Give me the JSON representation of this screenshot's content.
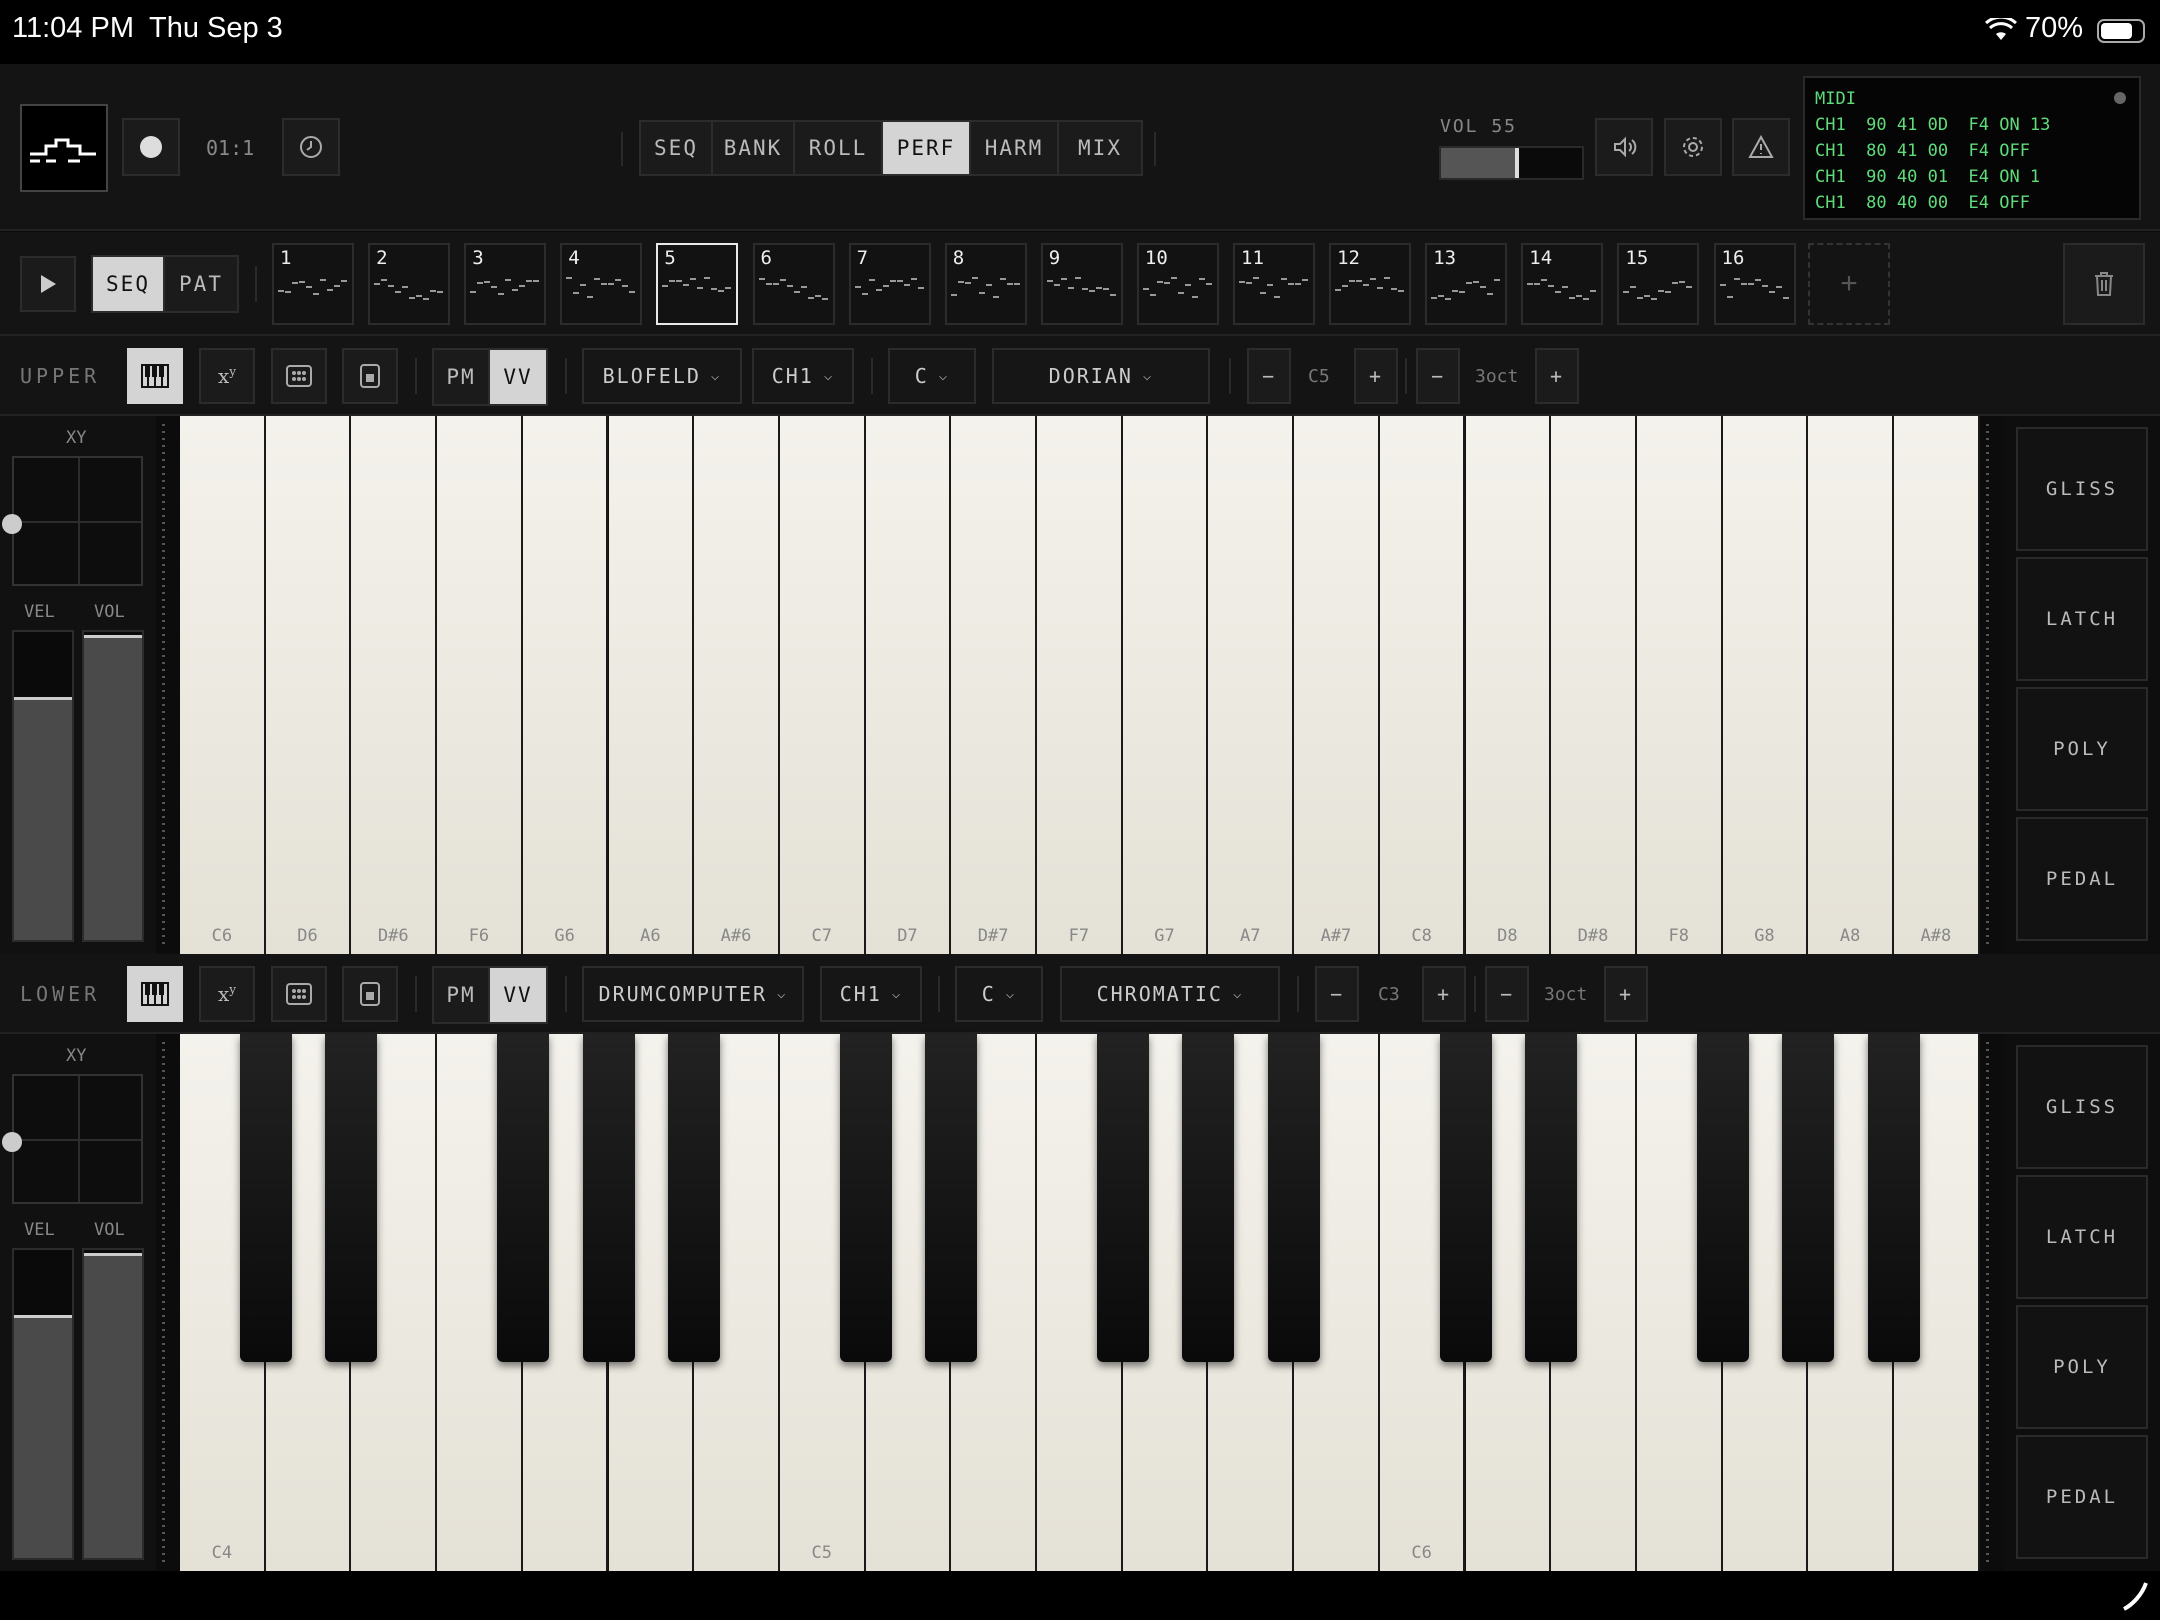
{
  "status": {
    "time": "11:04 PM",
    "date": "Thu Sep 3",
    "battery": "70%"
  },
  "top": {
    "record_time": "01:1",
    "tabs": [
      {
        "label": "SEQ",
        "active": false
      },
      {
        "label": "BANK",
        "active": false
      },
      {
        "label": "ROLL",
        "active": false
      },
      {
        "label": "PERF",
        "active": true
      },
      {
        "label": "HARM",
        "active": false
      },
      {
        "label": "MIX",
        "active": false
      }
    ],
    "volume_label": "VOL 55",
    "volume": 55
  },
  "midi": {
    "title": "MIDI",
    "lines": [
      "CH1  90 41 0D  F4 ON 13",
      "CH1  80 41 00  F4 OFF",
      "CH1  90 40 01  E4 ON 1",
      "CH1  80 40 00  E4 OFF"
    ]
  },
  "patterns": {
    "mode": [
      {
        "label": "SEQ",
        "active": true
      },
      {
        "label": "PAT",
        "active": false
      }
    ],
    "slots": [
      "1",
      "2",
      "3",
      "4",
      "5",
      "6",
      "7",
      "8",
      "9",
      "10",
      "11",
      "12",
      "13",
      "14",
      "15",
      "16"
    ],
    "selected": "5",
    "add_label": "+"
  },
  "upper": {
    "label": "UPPER",
    "pm": "PM",
    "vv": "VV",
    "instrument": "BLOFELD",
    "channel": "CH1",
    "key": "C",
    "scale": "DORIAN",
    "minus": "−",
    "plus": "+",
    "base_note": "C5",
    "octaves": "3oct",
    "xy_label": "XY",
    "vel_label": "VEL",
    "vol_label": "VOL",
    "vel": 0.79,
    "vol": 0.99,
    "keys": [
      "C6",
      "D6",
      "D#6",
      "F6",
      "G6",
      "A6",
      "A#6",
      "C7",
      "D7",
      "D#7",
      "F7",
      "G7",
      "A7",
      "A#7",
      "C8",
      "D8",
      "D#8",
      "F8",
      "G8",
      "A8",
      "A#8"
    ],
    "side_buttons": [
      "GLISS",
      "LATCH",
      "POLY",
      "PEDAL"
    ]
  },
  "lower": {
    "label": "LOWER",
    "pm": "PM",
    "vv": "VV",
    "instrument": "DRUMCOMPUTER",
    "channel": "CH1",
    "key": "C",
    "scale": "CHROMATIC",
    "minus": "−",
    "plus": "+",
    "base_note": "C3",
    "octaves": "3oct",
    "xy_label": "XY",
    "vel_label": "VEL",
    "vol_label": "VOL",
    "vel": 0.79,
    "vol": 0.99,
    "key_labels": {
      "c4": "C4",
      "c5": "C5",
      "c6": "C6"
    },
    "side_buttons": [
      "GLISS",
      "LATCH",
      "POLY",
      "PEDAL"
    ]
  }
}
